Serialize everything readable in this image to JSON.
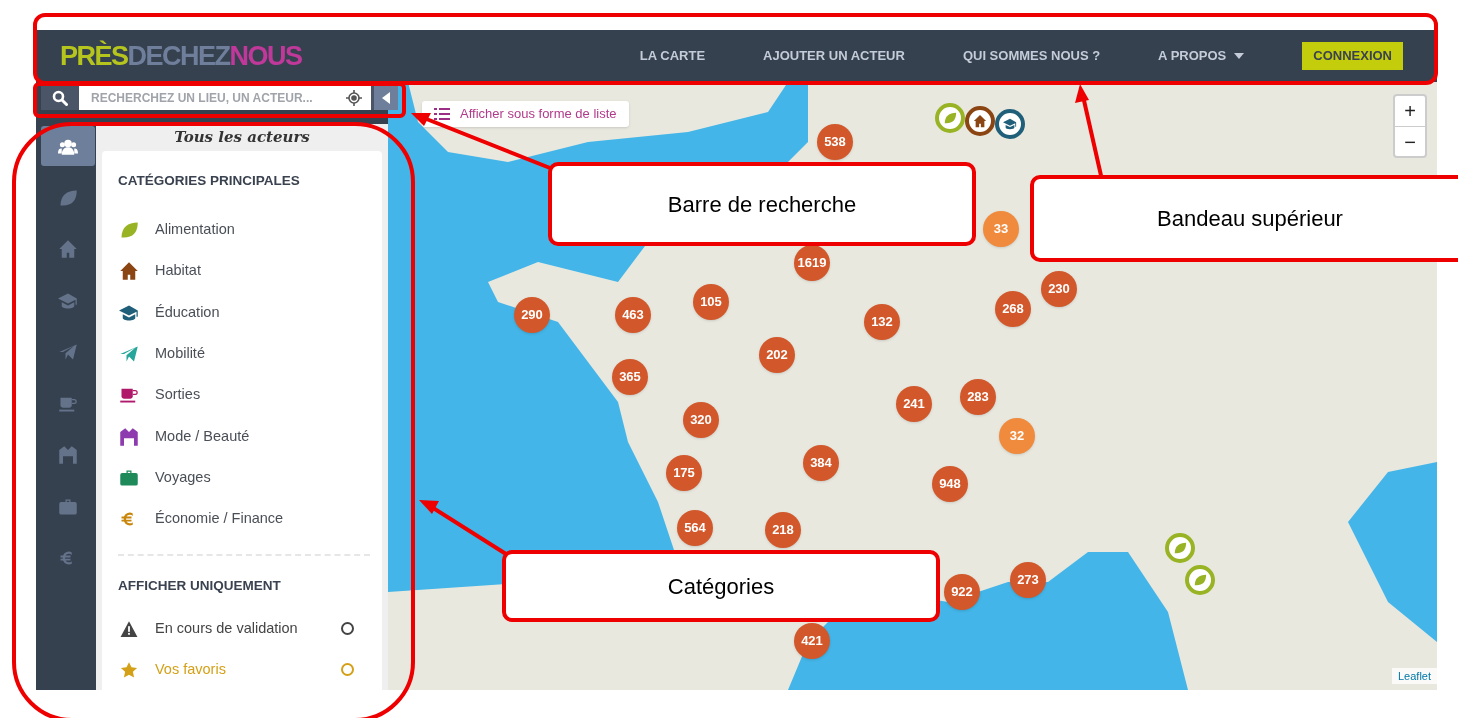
{
  "navbar": {
    "logo": [
      {
        "text": "PRÈS",
        "color": "#b5c51d"
      },
      {
        "text": "DECHEZ",
        "color": "#6f7f9b"
      },
      {
        "text": "NOUS",
        "color": "#c0399a"
      }
    ],
    "links": [
      {
        "label": "LA CARTE",
        "kind": "link"
      },
      {
        "label": "AJOUTER UN ACTEUR",
        "kind": "link"
      },
      {
        "label": "QUI SOMMES NOUS ?",
        "kind": "link"
      },
      {
        "label": "A PROPOS",
        "kind": "dropdown"
      },
      {
        "label": "CONNEXION",
        "kind": "button"
      }
    ]
  },
  "search": {
    "placeholder": "RECHERCHEZ UN LIEU, UN ACTEUR..."
  },
  "list_toggle": {
    "label": "Afficher sous forme de liste"
  },
  "sidebar": {
    "icons": [
      {
        "kind": "users",
        "selected": true
      },
      {
        "kind": "leaf",
        "selected": false
      },
      {
        "kind": "home",
        "selected": false
      },
      {
        "kind": "cap",
        "selected": false
      },
      {
        "kind": "plane",
        "selected": false
      },
      {
        "kind": "cup",
        "selected": false
      },
      {
        "kind": "shirt",
        "selected": false
      },
      {
        "kind": "suitcase",
        "selected": false
      },
      {
        "kind": "euro",
        "selected": false
      }
    ]
  },
  "panel": {
    "title": "Tous les acteurs",
    "categories": {
      "heading": "CATÉGORIES PRINCIPALES",
      "items": [
        {
          "label": "Alimentation",
          "kind": "leaf",
          "color": "#98b324"
        },
        {
          "label": "Habitat",
          "kind": "home",
          "color": "#8b4513"
        },
        {
          "label": "Éducation",
          "kind": "cap",
          "color": "#1f5f7a"
        },
        {
          "label": "Mobilité",
          "kind": "plane",
          "color": "#26a69a"
        },
        {
          "label": "Sorties",
          "kind": "cup",
          "color": "#b0186a"
        },
        {
          "label": "Mode / Beauté",
          "kind": "shirt",
          "color": "#8e3bb0"
        },
        {
          "label": "Voyages",
          "kind": "suitcase",
          "color": "#1e8a5a"
        },
        {
          "label": "Économie / Finance",
          "kind": "euro",
          "color": "#c8860a"
        }
      ]
    },
    "filters": {
      "heading": "AFFICHER UNIQUEMENT",
      "items": [
        {
          "label": "En cours de validation",
          "kind": "warning",
          "color": "#444444",
          "checked": false
        },
        {
          "label": "Vos favoris",
          "kind": "star",
          "color": "#d4a017",
          "checked": false
        }
      ]
    }
  },
  "map": {
    "clusters": [
      {
        "count": "538",
        "color": "#d2582b"
      },
      {
        "count": "1619",
        "color": "#d2582b"
      },
      {
        "count": "290",
        "color": "#d2582b"
      },
      {
        "count": "463",
        "color": "#d2582b"
      },
      {
        "count": "105",
        "color": "#d2582b"
      },
      {
        "count": "132",
        "color": "#d2582b"
      },
      {
        "count": "202",
        "color": "#d2582b"
      },
      {
        "count": "365",
        "color": "#d2582b"
      },
      {
        "count": "320",
        "color": "#d2582b"
      },
      {
        "count": "241",
        "color": "#d2582b"
      },
      {
        "count": "283",
        "color": "#d2582b"
      },
      {
        "count": "230",
        "color": "#d2582b"
      },
      {
        "count": "268",
        "color": "#d2582b"
      },
      {
        "count": "33",
        "color": "#f08a3c"
      },
      {
        "count": "32",
        "color": "#f08a3c"
      },
      {
        "count": "175",
        "color": "#d2582b"
      },
      {
        "count": "384",
        "color": "#d2582b"
      },
      {
        "count": "948",
        "color": "#d2582b"
      },
      {
        "count": "564",
        "color": "#d2582b"
      },
      {
        "count": "218",
        "color": "#d2582b"
      },
      {
        "count": "922",
        "color": "#d2582b"
      },
      {
        "count": "273",
        "color": "#d2582b"
      },
      {
        "count": "421",
        "color": "#d2582b"
      }
    ],
    "markers": [
      {
        "kind": "leaf",
        "color": "#98b324"
      },
      {
        "kind": "home",
        "color": "#8b4513"
      },
      {
        "kind": "cap",
        "color": "#1f5f7a"
      },
      {
        "kind": "leaf",
        "color": "#98b324"
      },
      {
        "kind": "leaf",
        "color": "#98b324"
      }
    ],
    "zoom": [
      "+",
      "−"
    ],
    "attribution": "Leaflet"
  },
  "annotations": [
    {
      "label": "Barre de recherche"
    },
    {
      "label": "Bandeau supérieur"
    },
    {
      "label": "Catégories"
    }
  ]
}
